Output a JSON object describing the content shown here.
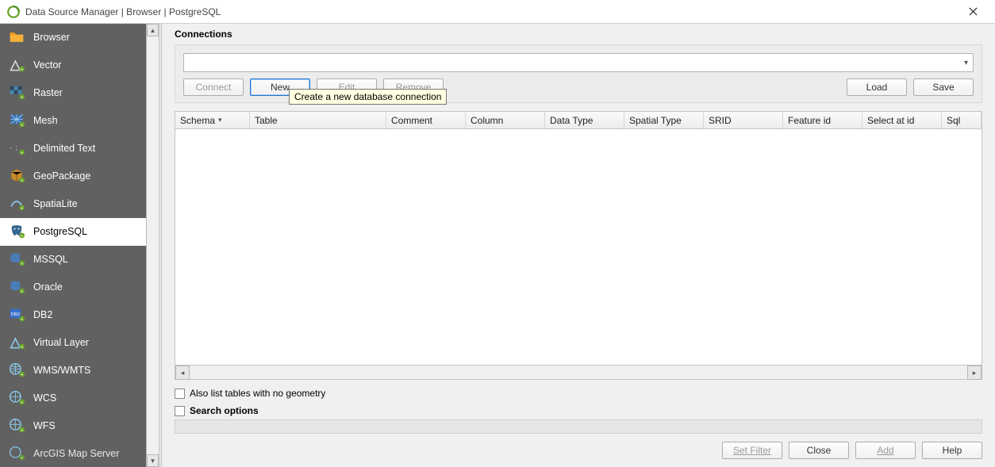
{
  "titlebar": {
    "title": "Data Source Manager | Browser | PostgreSQL"
  },
  "sidebar": {
    "items": [
      {
        "label": "Browser"
      },
      {
        "label": "Vector"
      },
      {
        "label": "Raster"
      },
      {
        "label": "Mesh"
      },
      {
        "label": "Delimited Text"
      },
      {
        "label": "GeoPackage"
      },
      {
        "label": "SpatiaLite"
      },
      {
        "label": "PostgreSQL",
        "selected": true
      },
      {
        "label": "MSSQL"
      },
      {
        "label": "Oracle"
      },
      {
        "label": "DB2"
      },
      {
        "label": "Virtual Layer"
      },
      {
        "label": "WMS/WMTS"
      },
      {
        "label": "WCS"
      },
      {
        "label": "WFS"
      },
      {
        "label": "ArcGIS Map Server"
      }
    ]
  },
  "connections": {
    "section_label": "Connections",
    "selected": "",
    "buttons": {
      "connect": "Connect",
      "new": "New",
      "edit": "Edit",
      "remove": "Remove",
      "load": "Load",
      "save": "Save"
    },
    "tooltip_new": "Create a new database connection"
  },
  "table": {
    "columns": {
      "schema": "Schema",
      "table": "Table",
      "comment": "Comment",
      "column": "Column",
      "data_type": "Data Type",
      "spatial_type": "Spatial Type",
      "srid": "SRID",
      "feature_id": "Feature id",
      "select_at_id": "Select at id",
      "sql": "Sql"
    },
    "rows": []
  },
  "options": {
    "also_list_no_geom": "Also list tables with no geometry",
    "search_options": "Search options",
    "also_list_checked": false,
    "search_expanded": false
  },
  "bottom_buttons": {
    "set_filter": "Set Filter",
    "close": "Close",
    "add": "Add",
    "help": "Help"
  }
}
